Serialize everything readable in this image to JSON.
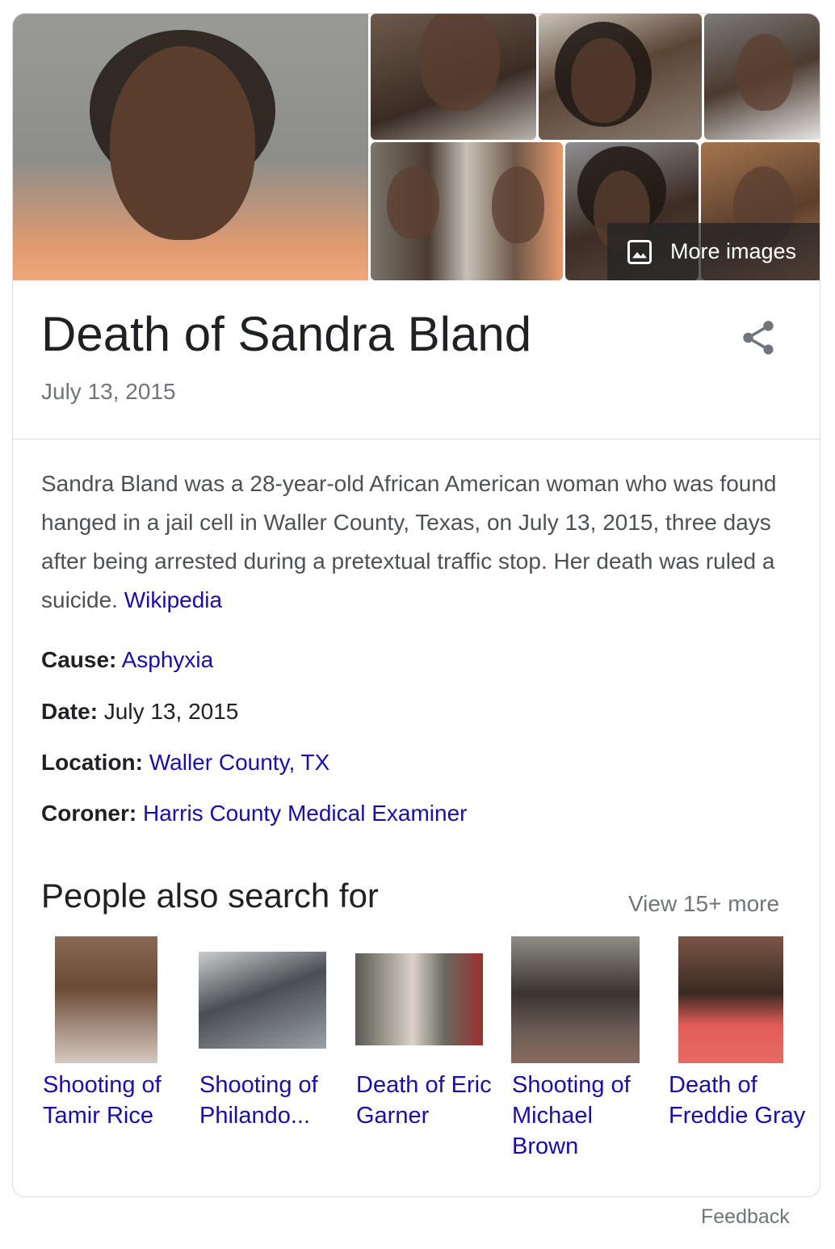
{
  "images": {
    "more_images_label": "More images"
  },
  "entity": {
    "title": "Death of Sandra Bland",
    "subtitle": "July 13, 2015"
  },
  "description": {
    "text": "Sandra Bland was a 28-year-old African American woman who was found hanged in a jail cell in Waller County, Texas, on July 13, 2015, three days after being arrested during a pretextual traffic stop. Her death was ruled a suicide.",
    "source": "Wikipedia"
  },
  "facts": [
    {
      "label": "Cause:",
      "value": "Asphyxia",
      "is_link": true
    },
    {
      "label": "Date:",
      "value": "July 13, 2015",
      "is_link": false
    },
    {
      "label": "Location:",
      "value": "Waller County, TX",
      "is_link": true
    },
    {
      "label": "Coroner:",
      "value": "Harris County Medical Examiner",
      "is_link": true
    }
  ],
  "people_also_search": {
    "title": "People also search for",
    "view_more": "View 15+ more",
    "items": [
      {
        "name": "Shooting of Tamir Rice"
      },
      {
        "name": "Shooting of Philando..."
      },
      {
        "name": "Death of Eric Garner"
      },
      {
        "name": "Shooting of Michael Brown"
      },
      {
        "name": "Death of Freddie Gray"
      }
    ]
  },
  "footer": {
    "feedback": "Feedback"
  },
  "colors": {
    "link": "#1a0dab",
    "secondary_text": "#70757a",
    "body_text": "#4d5156",
    "border": "#dadce0"
  },
  "icons": {
    "more_images": "image-icon",
    "share": "share-icon"
  }
}
